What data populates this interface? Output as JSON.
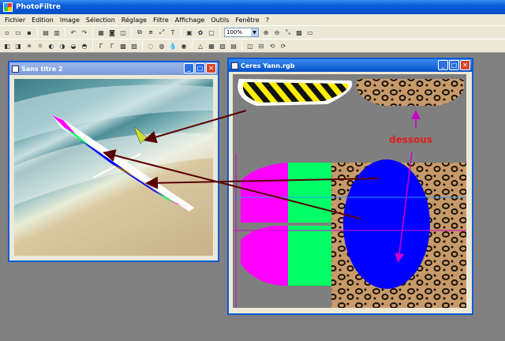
{
  "app": {
    "title": "PhotoFiltre"
  },
  "menu": [
    "Fichier",
    "Edition",
    "Image",
    "Sélection",
    "Réglage",
    "Filtre",
    "Affichage",
    "Outils",
    "Fenêtre",
    "?"
  ],
  "toolbar": {
    "zoom_value": "100%"
  },
  "windows": {
    "left": {
      "title": "Sans titre 2"
    },
    "right": {
      "title": "Ceres Yann.rgb"
    }
  },
  "annotation": {
    "dessous_label": "dessous"
  },
  "colors": {
    "magenta": "#ff00ff",
    "green": "#00ff66",
    "blue": "#0000ff",
    "arrow": "#5a0000",
    "label": "#e02020"
  }
}
